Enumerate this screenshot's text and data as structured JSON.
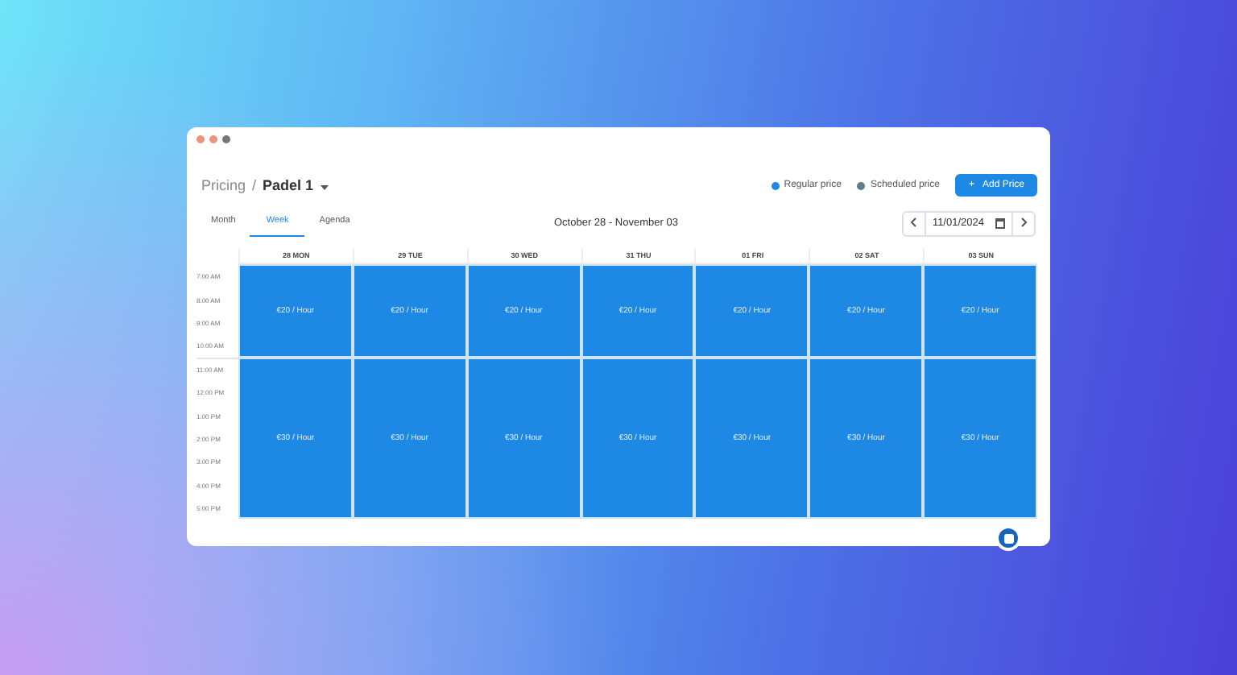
{
  "breadcrumb": {
    "parent": "Pricing",
    "separator": "/",
    "current": "Padel 1"
  },
  "legend": [
    {
      "label": "Regular price",
      "color": "#1e88e5"
    },
    {
      "label": "Scheduled price",
      "color": "#607d8b"
    }
  ],
  "add_button": {
    "icon": "+",
    "label": "Add Price"
  },
  "tabs": [
    {
      "label": "Month",
      "selected": false
    },
    {
      "label": "Week",
      "selected": true
    },
    {
      "label": "Agenda",
      "selected": false
    }
  ],
  "range_title": "October 28 - November 03",
  "date_field": {
    "value": "11/01/2024"
  },
  "time_slots": [
    {
      "label": "7:00 AM",
      "block_start": true
    },
    {
      "label": "8:00 AM",
      "block_start": false
    },
    {
      "label": "9:00 AM",
      "block_start": false
    },
    {
      "label": "10:00 AM",
      "block_start": false
    },
    {
      "label": "11:00 AM",
      "block_start": true
    },
    {
      "label": "12:00 PM",
      "block_start": false
    },
    {
      "label": "1:00 PM",
      "block_start": false
    },
    {
      "label": "2:00 PM",
      "block_start": false
    },
    {
      "label": "3:00 PM",
      "block_start": false
    },
    {
      "label": "4:00 PM",
      "block_start": false
    },
    {
      "label": "5:00 PM",
      "block_start": false
    }
  ],
  "days": [
    {
      "label": "28 MON",
      "prices": [
        "€20 / Hour",
        "€30 / Hour"
      ]
    },
    {
      "label": "29 TUE",
      "prices": [
        "€20 / Hour",
        "€30 / Hour"
      ]
    },
    {
      "label": "30 WED",
      "prices": [
        "€20 / Hour",
        "€30 / Hour"
      ]
    },
    {
      "label": "31 THU",
      "prices": [
        "€20 / Hour",
        "€30 / Hour"
      ]
    },
    {
      "label": "01 FRI",
      "prices": [
        "€20 / Hour",
        "€30 / Hour"
      ]
    },
    {
      "label": "02 SAT",
      "prices": [
        "€20 / Hour",
        "€30 / Hour"
      ]
    },
    {
      "label": "03 SUN",
      "prices": [
        "€20 / Hour",
        "€30 / Hour"
      ]
    }
  ]
}
